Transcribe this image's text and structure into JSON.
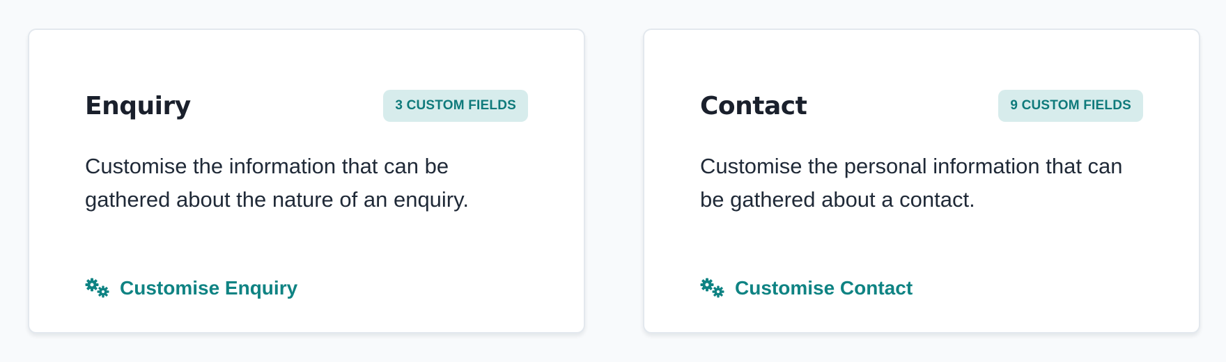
{
  "cards": [
    {
      "title": "Enquiry",
      "badge": "3 CUSTOM FIELDS",
      "description": "Customise the information that can be gathered about the nature of an enquiry.",
      "link_label": "Customise Enquiry",
      "link_icon": "gears-icon"
    },
    {
      "title": "Contact",
      "badge": "9 CUSTOM FIELDS",
      "description": "Customise the personal information that can be gathered about a contact.",
      "link_label": "Customise Contact",
      "link_icon": "gears-icon"
    }
  ],
  "colors": {
    "accent": "#0f8383",
    "badge_bg": "#d7ecec",
    "title": "#1a202c"
  }
}
